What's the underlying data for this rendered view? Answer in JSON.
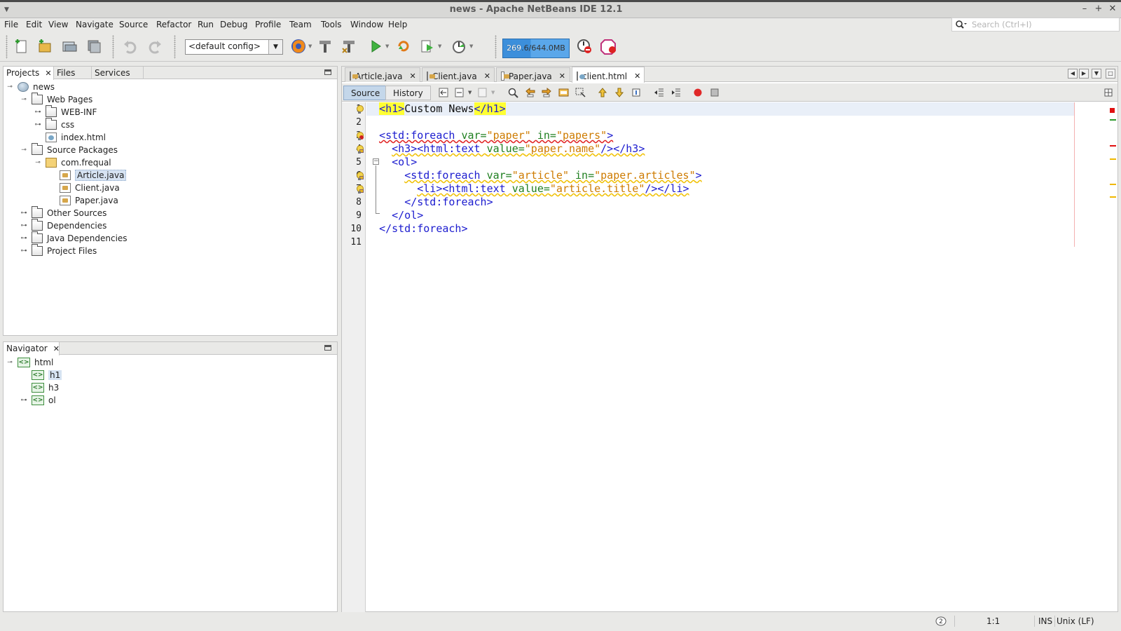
{
  "window": {
    "title": "news - Apache NetBeans IDE 12.1"
  },
  "menu": [
    "File",
    "Edit",
    "View",
    "Navigate",
    "Source",
    "Refactor",
    "Run",
    "Debug",
    "Profile",
    "Team",
    "Tools",
    "Window",
    "Help"
  ],
  "search": {
    "placeholder": "Search (Ctrl+I)"
  },
  "toolbar": {
    "config_value": "<default config>",
    "memory_used": "269",
    "memory_text": ".6/644.0MB",
    "memory_fraction": 0.42
  },
  "projects_panel": {
    "tabs": [
      "Projects",
      "Files",
      "Services"
    ],
    "tree": [
      {
        "label": "news",
        "icon": "web-project-icon"
      },
      {
        "label": "Web Pages",
        "icon": "folder-icon"
      },
      {
        "label": "WEB-INF",
        "icon": "folder-icon"
      },
      {
        "label": "css",
        "icon": "folder-icon"
      },
      {
        "label": "index.html",
        "icon": "html-file-icon"
      },
      {
        "label": "Source Packages",
        "icon": "folder-icon"
      },
      {
        "label": "com.frequal",
        "icon": "package-icon"
      },
      {
        "label": "Article.java",
        "icon": "java-file-icon"
      },
      {
        "label": "Client.java",
        "icon": "java-file-icon"
      },
      {
        "label": "Paper.java",
        "icon": "java-file-icon"
      },
      {
        "label": "Other Sources",
        "icon": "folder-icon"
      },
      {
        "label": "Dependencies",
        "icon": "folder-icon"
      },
      {
        "label": "Java Dependencies",
        "icon": "folder-icon"
      },
      {
        "label": "Project Files",
        "icon": "folder-icon"
      }
    ]
  },
  "navigator_panel": {
    "tab": "Navigator",
    "tree": [
      {
        "label": "html"
      },
      {
        "label": "h1"
      },
      {
        "label": "h3"
      },
      {
        "label": "ol"
      }
    ]
  },
  "editor": {
    "tabs": [
      "Article.java",
      "Client.java",
      "Paper.java",
      "client.html"
    ],
    "active_tab": "client.html",
    "view_buttons": [
      "Source",
      "History"
    ],
    "lines": [
      {
        "num": "1"
      },
      {
        "num": "2"
      },
      {
        "num": "3"
      },
      {
        "num": "4"
      },
      {
        "num": "5"
      },
      {
        "num": "6"
      },
      {
        "num": "7"
      },
      {
        "num": "8"
      },
      {
        "num": "9"
      },
      {
        "num": "10"
      },
      {
        "num": "11"
      }
    ],
    "code": {
      "l1": {
        "open": "<h1>",
        "text": "Custom News",
        "close": "</h1>"
      },
      "l3": {
        "tag": "<std:foreach ",
        "a1": "var=",
        "v1": "\"paper\"",
        "a2": " in=",
        "v2": "\"papers\"",
        "end": ">"
      },
      "l4": {
        "tag": "<h3><html:text ",
        "a1": "value=",
        "v1": "\"paper.name\"",
        "end": "/></h3>"
      },
      "l5": {
        "tag": "<ol>"
      },
      "l6": {
        "tag": "<std:foreach ",
        "a1": "var=",
        "v1": "\"article\"",
        "a2": " in=",
        "v2": "\"paper.articles\"",
        "end": ">"
      },
      "l7": {
        "tag": "<li><html:text ",
        "a1": "value=",
        "v1": "\"article.title\"",
        "end": "/></li>"
      },
      "l8": {
        "tag": "</std:foreach>"
      },
      "l9": {
        "tag": "</ol>"
      },
      "l10": {
        "tag": "</std:foreach>"
      }
    }
  },
  "status": {
    "position": "1:1",
    "mode": "INS",
    "line_ending": "Unix (LF)"
  },
  "colors": {
    "accent": "#3c8fdb",
    "tag": "#1c1ccf",
    "attr": "#1f7f1f",
    "value": "#ce7b00",
    "highlight": "#ffff33"
  }
}
